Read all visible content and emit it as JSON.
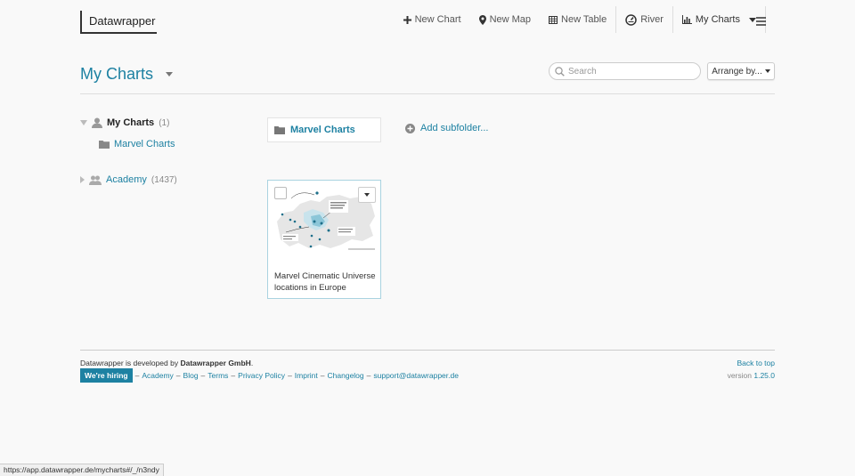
{
  "header": {
    "logo": "Datawrapper",
    "nav": {
      "new_chart": "New Chart",
      "new_map": "New Map",
      "new_table": "New Table",
      "river": "River",
      "my_charts": "My Charts"
    }
  },
  "toolbar": {
    "page_title": "My Charts",
    "search_placeholder": "Search",
    "arrange_label": "Arrange by..."
  },
  "sidebar": {
    "my_charts": {
      "label": "My Charts",
      "count": "(1)"
    },
    "subfolder": "Marvel Charts",
    "academy": {
      "label": "Academy",
      "count": "(1437)"
    }
  },
  "folder": {
    "name": "Marvel Charts",
    "add_subfolder": "Add subfolder..."
  },
  "charts": [
    {
      "title": "Marvel Cinematic Universe locations in Europe"
    }
  ],
  "footer": {
    "dev_prefix": "Datawrapper",
    "dev_middle": " is developed by ",
    "dev_company": "Datawrapper GmbH",
    "dev_suffix": ".",
    "hiring": "We're hiring",
    "links": [
      "Academy",
      "Blog",
      "Terms",
      "Privacy Policy",
      "Imprint",
      "Changelog",
      "support@datawrapper.de"
    ],
    "back_to_top": "Back to top",
    "version_label": "version",
    "version_number": "1.25.0"
  },
  "status_bar_url": "https://app.datawrapper.de/mycharts#/_/n3ndy",
  "colors": {
    "accent": "#1d81a2",
    "background": "#f9f9f9"
  }
}
